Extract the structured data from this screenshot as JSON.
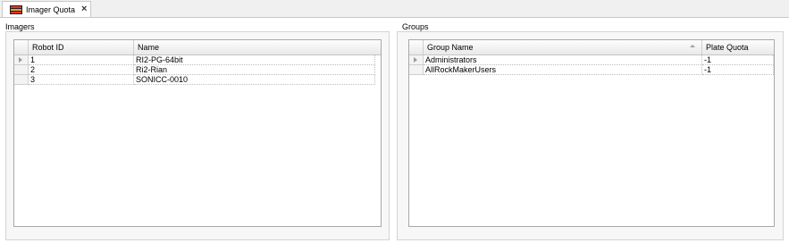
{
  "tab": {
    "label": "Imager Quota",
    "close": "×"
  },
  "imagers": {
    "title": "Imagers",
    "columns": [
      "Robot ID",
      "Name"
    ],
    "rows": [
      {
        "id": "1",
        "name": "RI2-PG-64bit"
      },
      {
        "id": "2",
        "name": "Ri2-Rian"
      },
      {
        "id": "3",
        "name": "SONICC-0010"
      }
    ]
  },
  "groups": {
    "title": "Groups",
    "columns": [
      "Group Name",
      "Plate Quota"
    ],
    "rows": [
      {
        "name": "Administrators",
        "quota": "-1"
      },
      {
        "name": "AllRockMakerUsers",
        "quota": "-1"
      }
    ]
  },
  "icons": {
    "tab": "imager-quota-icon",
    "row_pointer": "row-pointer-icon",
    "sort": "sort-ascending-icon"
  }
}
